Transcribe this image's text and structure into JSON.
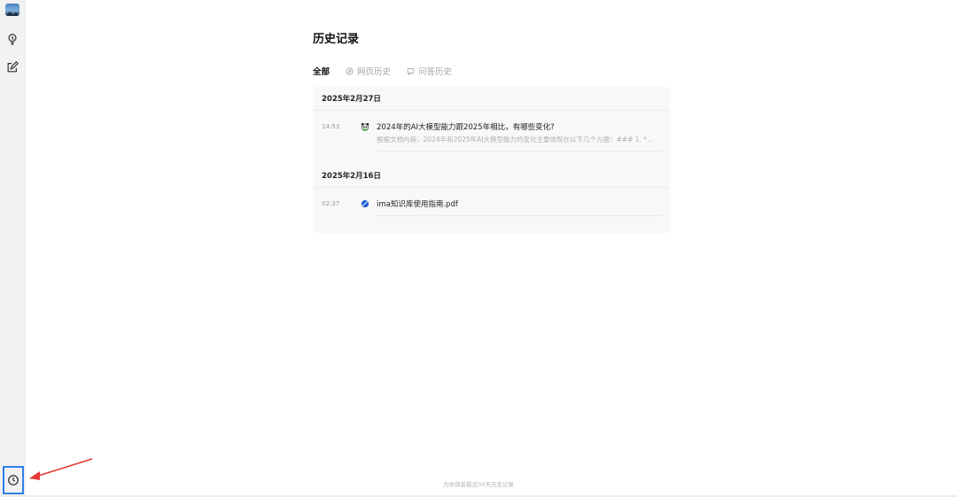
{
  "sidebar": {
    "items": [
      {
        "icon": "lightbulb-icon"
      },
      {
        "icon": "edit-icon"
      }
    ],
    "history_icon": "clock-icon"
  },
  "page": {
    "title": "历史记录"
  },
  "tabs": [
    {
      "label": "全部",
      "active": true
    },
    {
      "label": "网页历史",
      "icon": "compass-icon",
      "active": false
    },
    {
      "label": "问答历史",
      "icon": "chat-icon",
      "active": false
    }
  ],
  "groups": [
    {
      "date": "2025年2月27日",
      "items": [
        {
          "time": "14:53",
          "icon": "panda-icon",
          "title": "2024年的AI大模型能力跟2025年相比，有哪些变化?",
          "snippet": "根据文档内容，2024年和2025年AI大模型能力的变化主要体现在以下几个方面：### 1. *..."
        }
      ]
    },
    {
      "date": "2025年2月16日",
      "items": [
        {
          "time": "02:37",
          "icon": "ima-logo-icon",
          "title": "ima知识库使用指南.pdf"
        }
      ]
    }
  ],
  "footer": {
    "note": "为你保留最近30天历史记录"
  },
  "colors": {
    "highlight": "#2f80ed",
    "arrow": "#e53935"
  }
}
